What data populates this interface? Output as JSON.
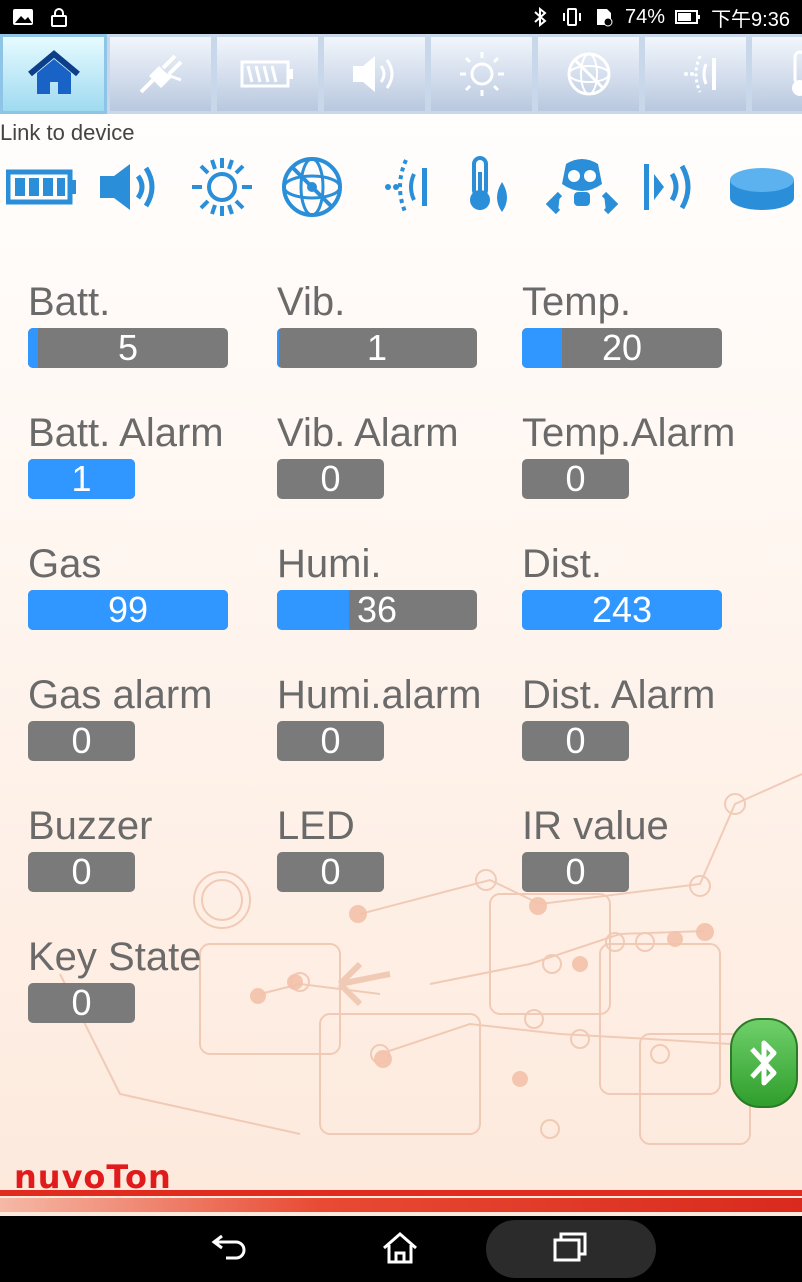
{
  "status_bar": {
    "battery_percent": "74%",
    "time": "下午9:36",
    "icons": [
      "image-icon",
      "lock-icon",
      "bluetooth-icon",
      "vibrate-icon",
      "sim-icon",
      "battery-icon"
    ]
  },
  "tabs": [
    {
      "name": "home",
      "icon": "home-icon",
      "active": true
    },
    {
      "name": "link",
      "icon": "plug-icon",
      "active": false
    },
    {
      "name": "battery",
      "icon": "battery-icon",
      "active": false
    },
    {
      "name": "sound",
      "icon": "speaker-icon",
      "active": false
    },
    {
      "name": "light",
      "icon": "sun-icon",
      "active": false
    },
    {
      "name": "gyro",
      "icon": "gyroscope-icon",
      "active": false
    },
    {
      "name": "vibration",
      "icon": "vibration-icon",
      "active": false
    },
    {
      "name": "temperature",
      "icon": "thermometer-icon",
      "active": false
    }
  ],
  "link_label": "Link to device",
  "device_icons": [
    "battery-icon",
    "speaker-icon",
    "sun-icon",
    "gyroscope-icon",
    "vibration-icon",
    "temperature-humidity-icon",
    "gas-mask-icon",
    "distance-signal-icon",
    "button-icon"
  ],
  "sensors": {
    "batt": {
      "label": "Batt.",
      "value": "5",
      "fill_fraction": 0.05
    },
    "vib": {
      "label": "Vib.",
      "value": "1",
      "fill_fraction": 0.01
    },
    "temp": {
      "label": "Temp.",
      "value": "20",
      "fill_fraction": 0.2
    },
    "batt_alarm": {
      "label": "Batt. Alarm",
      "value": "1",
      "fill_fraction": 1
    },
    "vib_alarm": {
      "label": "Vib. Alarm",
      "value": "0",
      "fill_fraction": 0
    },
    "temp_alarm": {
      "label": "Temp.Alarm",
      "value": "0",
      "fill_fraction": 0
    },
    "gas": {
      "label": "Gas",
      "value": "99",
      "fill_fraction": 1
    },
    "humi": {
      "label": "Humi.",
      "value": "36",
      "fill_fraction": 0.36
    },
    "dist": {
      "label": "Dist.",
      "value": "243",
      "fill_fraction": 1
    },
    "gas_alarm": {
      "label": "Gas alarm",
      "value": "0",
      "fill_fraction": 0
    },
    "humi_alarm": {
      "label": "Humi.alarm",
      "value": "0",
      "fill_fraction": 0
    },
    "dist_alarm": {
      "label": "Dist. Alarm",
      "value": "0",
      "fill_fraction": 0
    },
    "buzzer": {
      "label": "Buzzer",
      "value": "0",
      "fill_fraction": 0
    },
    "led": {
      "label": "LED",
      "value": "0",
      "fill_fraction": 0
    },
    "ir_value": {
      "label": "IR value",
      "value": "0",
      "fill_fraction": 0
    },
    "key_state": {
      "label": "Key State",
      "value": "0",
      "fill_fraction": 0
    }
  },
  "logo": "nuvoTon",
  "bluetooth_button": {
    "icon": "bluetooth-icon"
  },
  "nav_bar": {
    "back": "back-icon",
    "home": "home-icon",
    "recents": "recents-icon"
  },
  "colors": {
    "bar_fill": "#2f97ff",
    "bar_bg": "#7a7a7a",
    "label": "#6a6a6a",
    "brand": "#e11b1b"
  }
}
